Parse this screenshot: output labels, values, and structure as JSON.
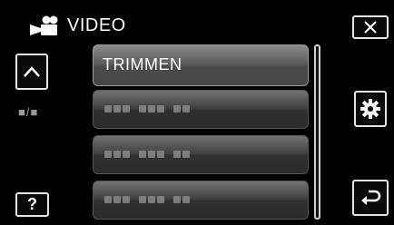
{
  "header": {
    "title": "VIDEO",
    "icon": "video-camera-icon"
  },
  "buttons": {
    "close": {
      "icon": "close-icon",
      "glyph": "✕"
    },
    "up": {
      "icon": "chevron-up-icon"
    },
    "help": {
      "label": "?"
    },
    "settings": {
      "icon": "gear-icon"
    },
    "back": {
      "icon": "return-arrow-icon"
    }
  },
  "page_indicator": "■/■",
  "menu": {
    "items": [
      {
        "label": "TRIMMEN",
        "selected": true
      },
      {
        "label": "",
        "selected": false
      },
      {
        "label": "",
        "selected": false
      },
      {
        "label": "",
        "selected": false
      }
    ]
  }
}
